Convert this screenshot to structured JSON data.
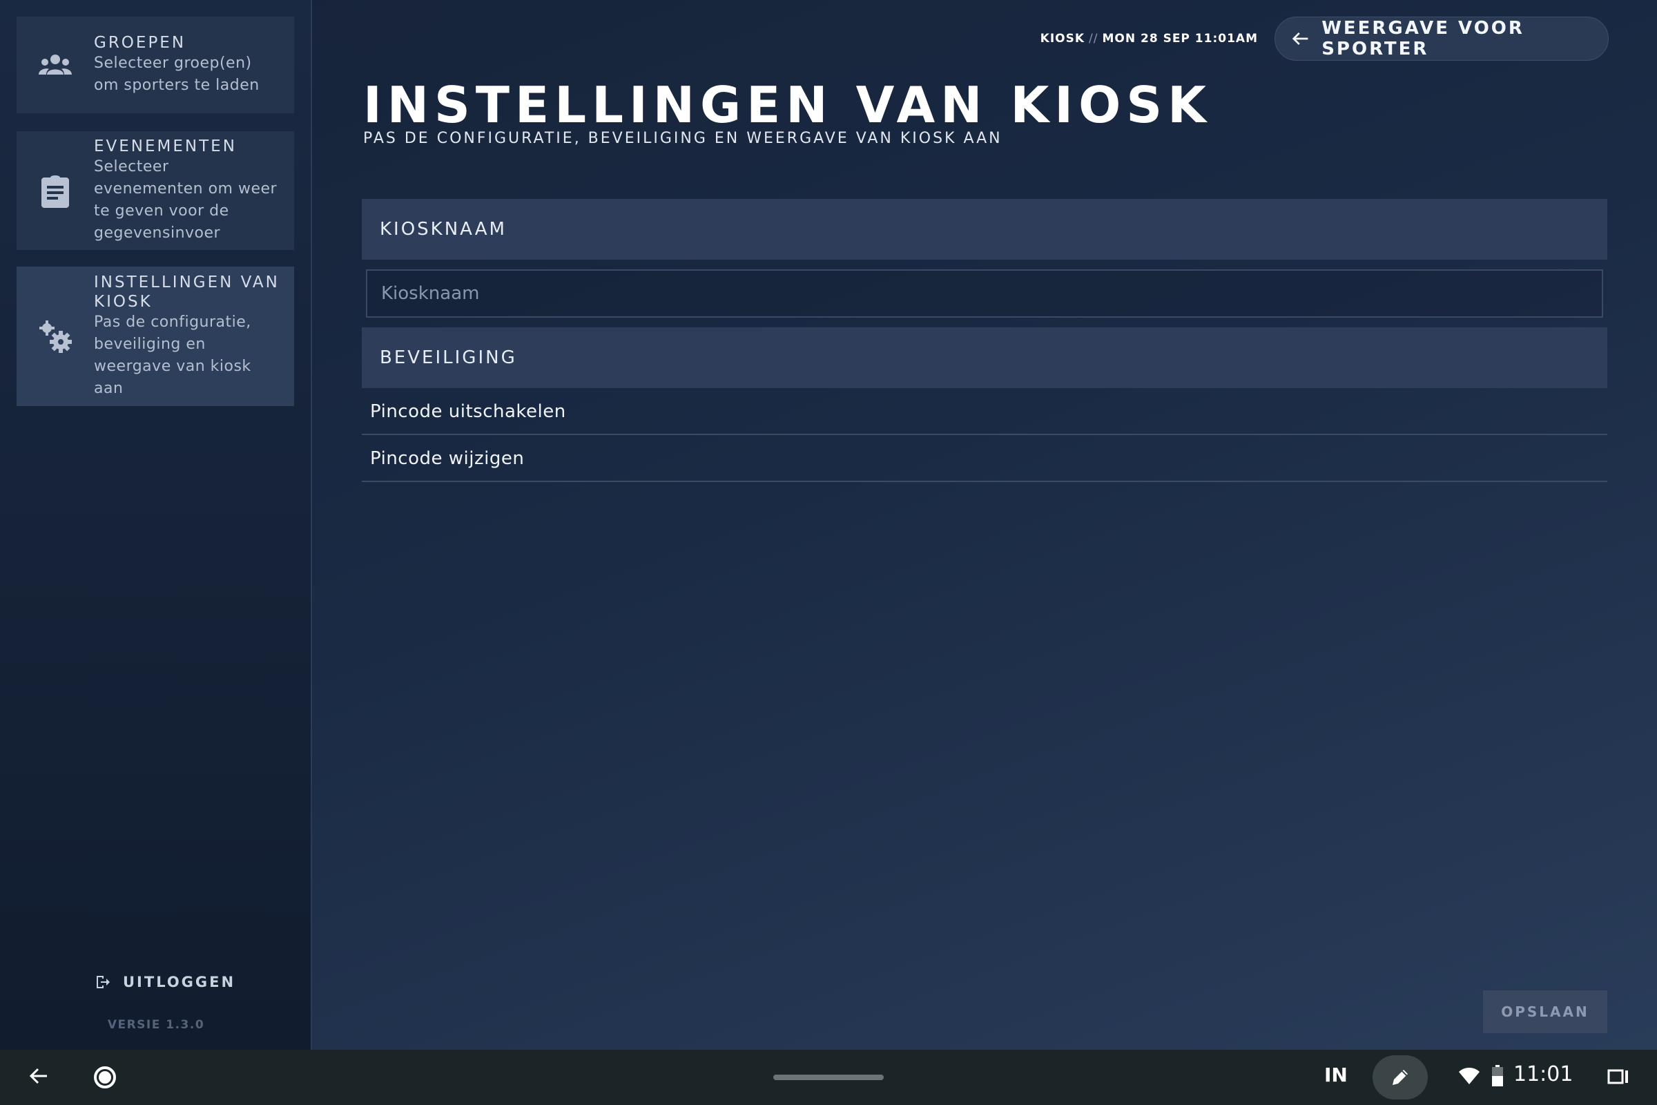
{
  "sidebar": {
    "groups": {
      "title": "GROEPEN",
      "desc": "Selecteer groep(en) om sporters te laden",
      "icon": "group-icon"
    },
    "events": {
      "title": "EVENEMENTEN",
      "desc": "Selecteer evenementen om weer te geven voor de gegevensinvoer",
      "icon": "clipboard-icon"
    },
    "settings": {
      "title": "INSTELLINGEN VAN KIOSK",
      "desc": "Pas de configuratie, beveiliging en weergave van kiosk aan",
      "icon": "gears-icon"
    },
    "logout_label": "UITLOGGEN",
    "version": "VERSIE 1.3.0"
  },
  "header": {
    "app": "KIOSK",
    "separator": "//",
    "datetime": "MON 28 SEP 11:01AM",
    "back_label": "WEERGAVE VOOR SPORTER"
  },
  "page": {
    "title": "INSTELLINGEN VAN KIOSK",
    "subtitle": "PAS DE CONFIGURATIE, BEVEILIGING EN WEERGAVE VAN KIOSK AAN"
  },
  "sections": {
    "kiosk_name": {
      "title": "KIOSKNAAM",
      "placeholder": "Kiosknaam",
      "value": ""
    },
    "security": {
      "title": "BEVEILIGING",
      "items": [
        "Pincode uitschakelen",
        "Pincode wijzigen"
      ]
    }
  },
  "save_label": "OPSLAAN",
  "navbar": {
    "lang": "IN",
    "time": "11:01"
  },
  "colors": {
    "background": "#1a2a44",
    "card": "#25344d",
    "section_header": "#2e3e5a",
    "navbar": "#1b2528"
  }
}
